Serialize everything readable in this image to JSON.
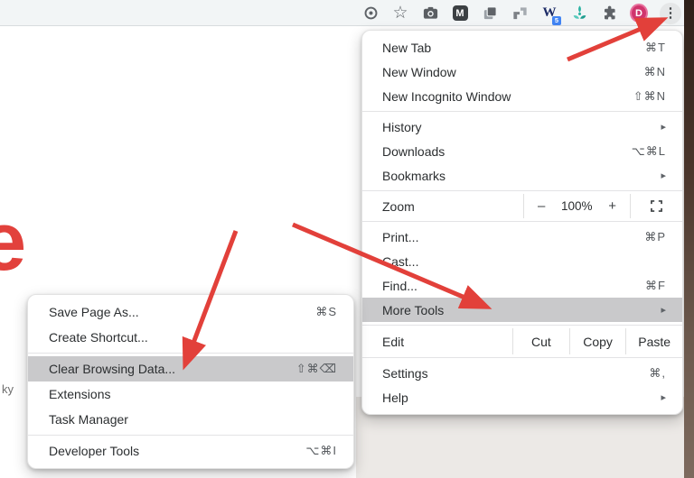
{
  "toolbar": {
    "icons": [
      {
        "name": "target-icon"
      },
      {
        "name": "bookmark-star-icon",
        "glyph": "☆"
      },
      {
        "name": "camera-icon"
      },
      {
        "name": "m-extension-icon",
        "letter": "M"
      },
      {
        "name": "copy-pages-icon"
      },
      {
        "name": "pipes-extension-icon"
      },
      {
        "name": "w-extension-icon",
        "letter": "W",
        "badge": "5"
      },
      {
        "name": "trident-extension-icon"
      },
      {
        "name": "extensions-puzzle-icon"
      },
      {
        "name": "profile-avatar",
        "letter": "D"
      },
      {
        "name": "menu-kebab-icon",
        "glyph": "⋮"
      }
    ]
  },
  "page": {
    "big_letter": "e",
    "partial_text": "ky"
  },
  "icons": {
    "submenu_arrow": "▸"
  },
  "main_menu": {
    "items": [
      {
        "label": "New Tab",
        "shortcut": "⌘T"
      },
      {
        "label": "New Window",
        "shortcut": "⌘N"
      },
      {
        "label": "New Incognito Window",
        "shortcut": "⇧⌘N"
      },
      {
        "type": "separator"
      },
      {
        "label": "History",
        "submenu": true
      },
      {
        "label": "Downloads",
        "shortcut": "⌥⌘L"
      },
      {
        "label": "Bookmarks",
        "submenu": true
      },
      {
        "type": "separator"
      },
      {
        "type": "zoom",
        "label": "Zoom",
        "minus": "–",
        "value": "100%",
        "plus": "+"
      },
      {
        "type": "separator"
      },
      {
        "label": "Print...",
        "shortcut": "⌘P"
      },
      {
        "label": "Cast..."
      },
      {
        "label": "Find...",
        "shortcut": "⌘F"
      },
      {
        "label": "More Tools",
        "submenu": true,
        "highlighted": true
      },
      {
        "type": "separator"
      },
      {
        "type": "edit",
        "label": "Edit",
        "actions": [
          "Cut",
          "Copy",
          "Paste"
        ]
      },
      {
        "type": "separator"
      },
      {
        "label": "Settings",
        "shortcut": "⌘,"
      },
      {
        "label": "Help",
        "submenu": true
      }
    ]
  },
  "submenu": {
    "items": [
      {
        "label": "Save Page As...",
        "shortcut": "⌘S"
      },
      {
        "label": "Create Shortcut..."
      },
      {
        "type": "separator"
      },
      {
        "label": "Clear Browsing Data...",
        "shortcut": "⇧⌘⌫",
        "highlighted": true
      },
      {
        "label": "Extensions"
      },
      {
        "label": "Task Manager"
      },
      {
        "type": "separator"
      },
      {
        "label": "Developer Tools",
        "shortcut": "⌥⌘I"
      }
    ]
  },
  "colors": {
    "arrow_red": "#e2403a",
    "highlight_gray": "#c9c9cb",
    "avatar_pink": "#d0346d",
    "badge_blue": "#4285f4",
    "teal": "#2bb3a3"
  }
}
